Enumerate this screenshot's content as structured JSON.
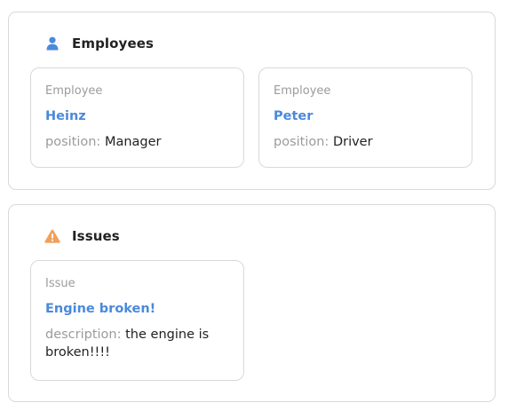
{
  "employees": {
    "title": "Employees",
    "icon": "person-icon",
    "cards": [
      {
        "type": "Employee",
        "name": "Heinz",
        "field_key": "position:",
        "field_value": "Manager"
      },
      {
        "type": "Employee",
        "name": "Peter",
        "field_key": "position:",
        "field_value": "Driver"
      }
    ]
  },
  "issues": {
    "title": "Issues",
    "icon": "warning-icon",
    "cards": [
      {
        "type": "Issue",
        "name": "Engine broken!",
        "field_key": "description:",
        "field_value": "the engine is broken!!!!"
      }
    ]
  },
  "colors": {
    "accent": "#4a89dc",
    "warning": "#f0a05a",
    "muted_text": "#9b9b9b",
    "border": "#d9d9d9"
  }
}
